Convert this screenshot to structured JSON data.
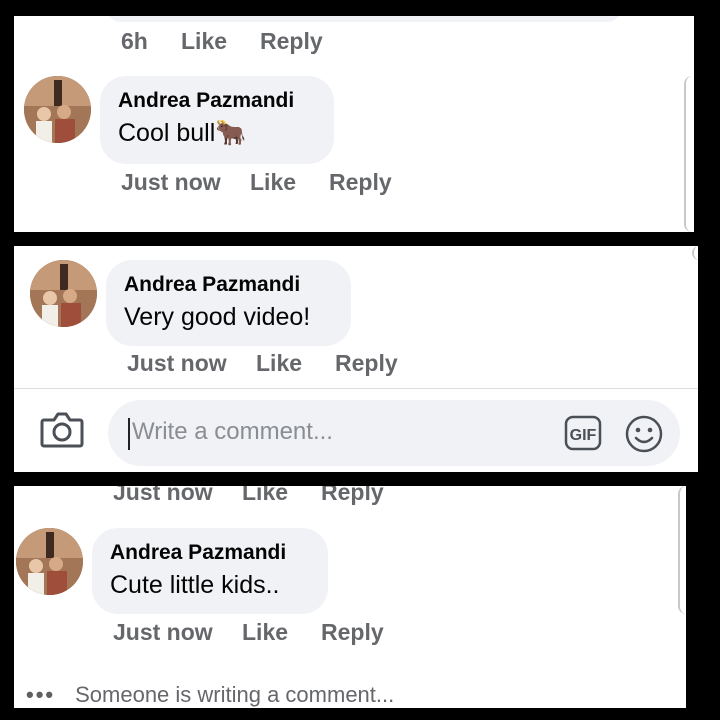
{
  "colors": {
    "bubble": "#f0f2f5",
    "secondary_text": "#65676b",
    "background": "#000000"
  },
  "icons": [
    "camera-icon",
    "gif-icon",
    "smiley-icon",
    "typing-dots-icon"
  ],
  "panel1": {
    "prev_comment": {
      "time": "6h",
      "like": "Like",
      "reply": "Reply"
    },
    "comment": {
      "author": "Andrea Pazmandi",
      "text": "Cool bull🐂",
      "time": "Just now",
      "like": "Like",
      "reply": "Reply"
    }
  },
  "panel2": {
    "comment": {
      "author": "Andrea Pazmandi",
      "text": "Very good video!",
      "time": "Just now",
      "like": "Like",
      "reply": "Reply"
    },
    "composer": {
      "placeholder": "Write a comment...",
      "gif_label": "GIF"
    }
  },
  "panel3": {
    "prev_comment": {
      "time": "Just now",
      "like": "Like",
      "reply": "Reply"
    },
    "comment": {
      "author": "Andrea Pazmandi",
      "text": "Cute little kids..",
      "time": "Just now",
      "like": "Like",
      "reply": "Reply"
    },
    "typing_indicator": {
      "dots": "•••",
      "text": "Someone is writing a comment..."
    }
  }
}
